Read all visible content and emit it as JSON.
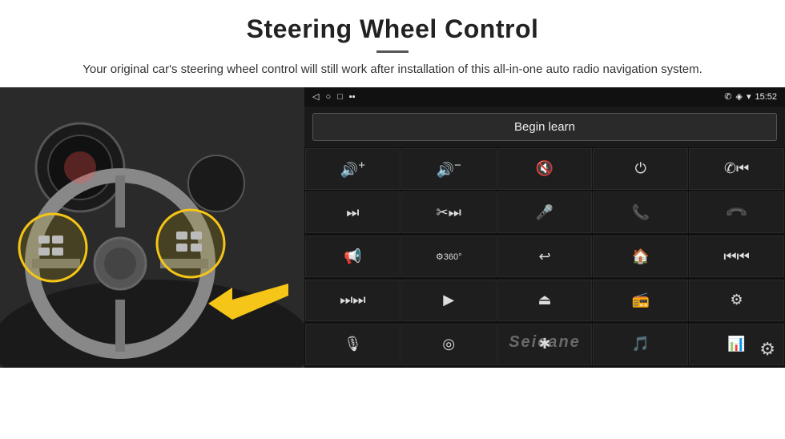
{
  "header": {
    "title": "Steering Wheel Control",
    "divider": true,
    "subtitle": "Your original car's steering wheel control will still work after installation of this all-in-one auto radio navigation system."
  },
  "statusbar": {
    "back_icon": "◁",
    "home_icon": "○",
    "recent_icon": "□",
    "signal_icon": "▪▪",
    "phone_icon": "📞",
    "location_icon": "◈",
    "wifi_icon": "▼",
    "time": "15:52"
  },
  "control": {
    "begin_learn_label": "Begin learn"
  },
  "icon_grid": [
    {
      "icon": "🔊+",
      "label": "vol-up"
    },
    {
      "icon": "🔊−",
      "label": "vol-down"
    },
    {
      "icon": "🔇",
      "label": "mute"
    },
    {
      "icon": "⏻",
      "label": "power"
    },
    {
      "icon": "⏮",
      "label": "prev-track-phone"
    },
    {
      "icon": "⏭",
      "label": "next"
    },
    {
      "icon": "⏭⏭",
      "label": "fast-forward"
    },
    {
      "icon": "🎤",
      "label": "mic"
    },
    {
      "icon": "📞",
      "label": "phone"
    },
    {
      "icon": "↩",
      "label": "hang-up"
    },
    {
      "icon": "📢",
      "label": "speaker"
    },
    {
      "icon": "360°",
      "label": "camera-360"
    },
    {
      "icon": "↩",
      "label": "back"
    },
    {
      "icon": "🏠",
      "label": "home"
    },
    {
      "icon": "⏮⏮",
      "label": "skip-back"
    },
    {
      "icon": "⏭",
      "label": "skip-fwd"
    },
    {
      "icon": "▶",
      "label": "navigate"
    },
    {
      "icon": "⏏",
      "label": "eject"
    },
    {
      "icon": "📻",
      "label": "radio"
    },
    {
      "icon": "⚙",
      "label": "settings-eq"
    },
    {
      "icon": "🎤",
      "label": "mic2"
    },
    {
      "icon": "⚙",
      "label": "wheel"
    },
    {
      "icon": "✱",
      "label": "bluetooth"
    },
    {
      "icon": "🎵",
      "label": "music"
    },
    {
      "icon": "📊",
      "label": "eq"
    }
  ],
  "watermark": "Seicane",
  "gear_icon": "⚙"
}
